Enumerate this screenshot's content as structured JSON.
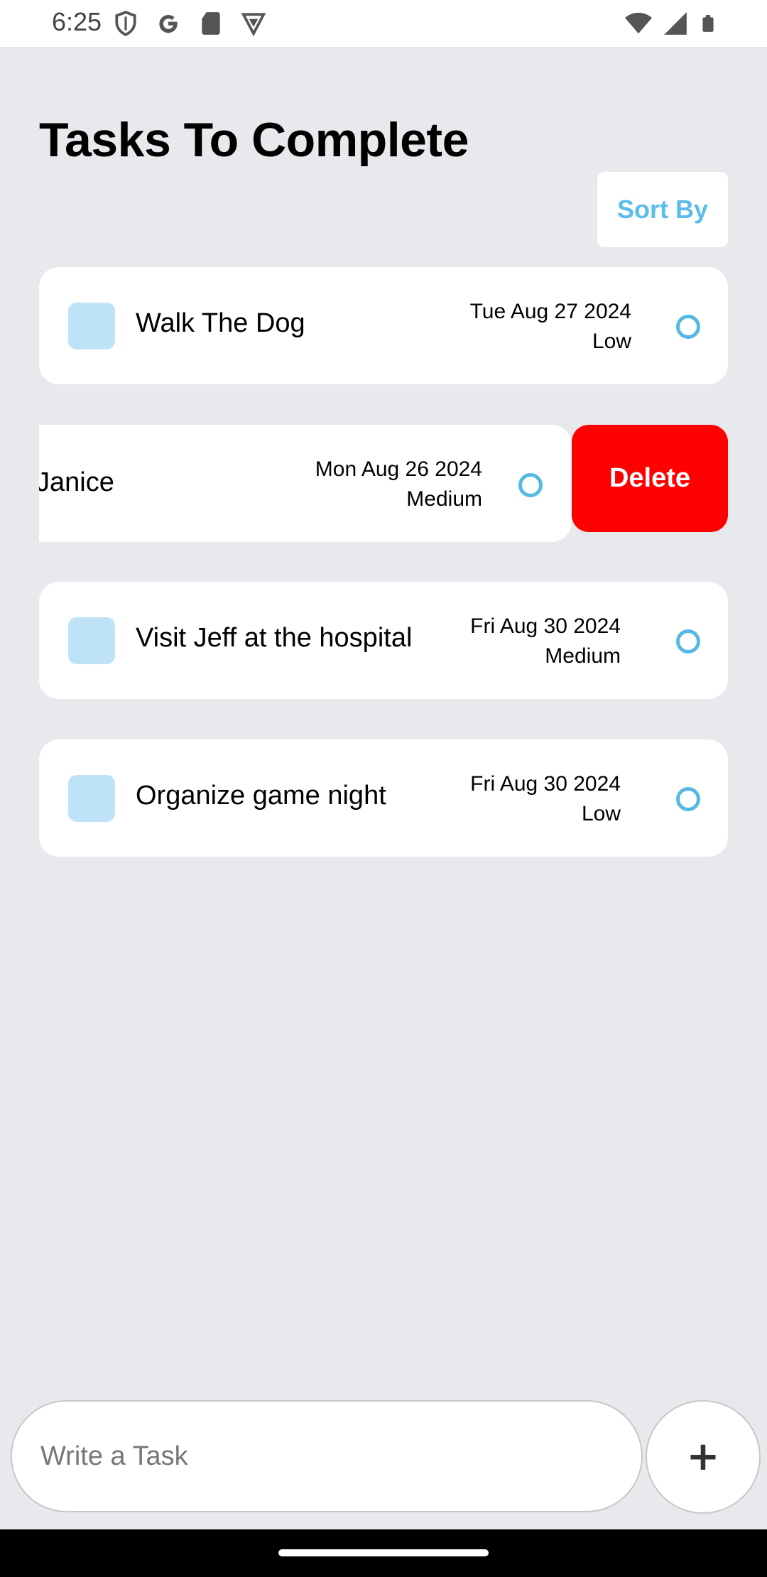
{
  "status_bar": {
    "time": "6:25",
    "left_icons": [
      "shield-icon",
      "google-icon",
      "sd-card-icon",
      "vpn-icon"
    ],
    "right_icons": [
      "wifi-icon",
      "signal-icon",
      "battery-icon"
    ]
  },
  "header": {
    "title": "Tasks To Complete",
    "sort_label": "Sort By"
  },
  "tasks": [
    {
      "title": "Walk The Dog",
      "date": "Tue Aug 27 2024",
      "priority": "Low"
    },
    {
      "title": "Janice",
      "date": "Mon Aug 26 2024",
      "priority": "Medium",
      "swiped": true
    },
    {
      "title": "Visit Jeff at the hospital",
      "date": "Fri Aug 30 2024",
      "priority": "Medium"
    },
    {
      "title": "Organize game night",
      "date": "Fri Aug 30 2024",
      "priority": "Low"
    }
  ],
  "delete_label": "Delete",
  "composer": {
    "placeholder": "Write a Task",
    "add_label": "+"
  },
  "colors": {
    "background": "#e8e9ed",
    "accent": "#5bbde9",
    "checkbox": "#bee3f8",
    "delete": "#ff0000"
  }
}
